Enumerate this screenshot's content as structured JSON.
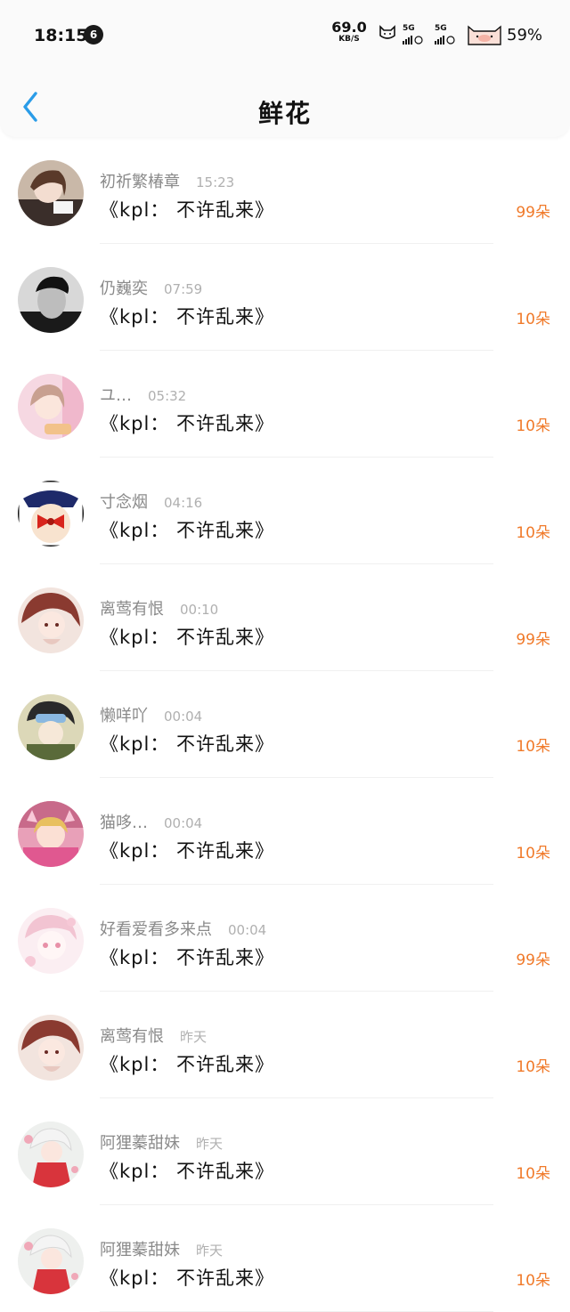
{
  "status_bar": {
    "time": "18:15",
    "notification_count": "6",
    "net_speed": "69.0",
    "net_speed_unit": "KB/S",
    "signal1": "5G",
    "signal2": "5G",
    "battery": "59%"
  },
  "header": {
    "title": "鲜花",
    "back_icon": "chevron-left-icon",
    "accent_color": "#2a9ce8"
  },
  "colors": {
    "count_color": "#f07a2a",
    "name_color": "#8a8a8a",
    "time_color": "#b0b0b0"
  },
  "rows": [
    {
      "name": "初祈繁椿章",
      "time": "15:23",
      "message": "《kpl： 不许乱来》",
      "count": "99朵"
    },
    {
      "name": "仍巍奕",
      "time": "07:59",
      "message": "《kpl： 不许乱来》",
      "count": "10朵"
    },
    {
      "name": "ユ…",
      "time": "05:32",
      "message": "《kpl： 不许乱来》",
      "count": "10朵"
    },
    {
      "name": "寸念烟",
      "time": "04:16",
      "message": "《kpl： 不许乱来》",
      "count": "10朵"
    },
    {
      "name": "离莺有恨",
      "time": "00:10",
      "message": "《kpl： 不许乱来》",
      "count": "99朵"
    },
    {
      "name": "懒咩吖",
      "time": "00:04",
      "message": "《kpl： 不许乱来》",
      "count": "10朵"
    },
    {
      "name": "猫哆…",
      "time": "00:04",
      "message": "《kpl： 不许乱来》",
      "count": "10朵"
    },
    {
      "name": "好看爱看多来点",
      "time": "00:04",
      "message": "《kpl： 不许乱来》",
      "count": "99朵"
    },
    {
      "name": "离莺有恨",
      "time": "昨天",
      "message": "《kpl： 不许乱来》",
      "count": "10朵"
    },
    {
      "name": "阿狸蓁甜妹",
      "time": "昨天",
      "message": "《kpl： 不许乱来》",
      "count": "10朵"
    },
    {
      "name": "阿狸蓁甜妹",
      "time": "昨天",
      "message": "《kpl： 不许乱来》",
      "count": "10朵"
    }
  ]
}
